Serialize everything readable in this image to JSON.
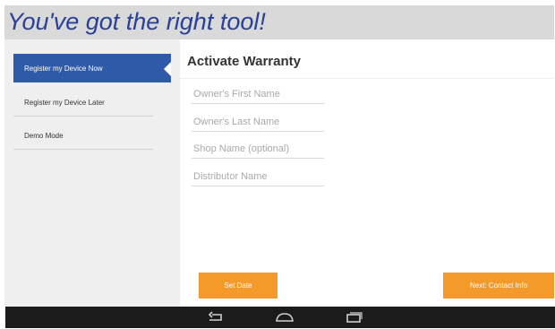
{
  "header": {
    "title": "You've got the right tool!"
  },
  "sidebar": {
    "items": [
      {
        "label": "Register my Device Now",
        "active": true
      },
      {
        "label": "Register my Device Later",
        "active": false
      },
      {
        "label": "Demo Mode",
        "active": false
      }
    ]
  },
  "form": {
    "title": "Activate Warranty",
    "fields": [
      {
        "placeholder": "Owner's First Name",
        "value": ""
      },
      {
        "placeholder": "Owner's Last Name",
        "value": ""
      },
      {
        "placeholder": "Shop Name (optional)",
        "value": ""
      },
      {
        "placeholder": "Distributor Name",
        "value": ""
      }
    ],
    "set_date_label": "Set Date",
    "next_label": "Next: Contact Info"
  },
  "navbar": {
    "icons": [
      "back-icon",
      "home-icon",
      "recent-apps-icon"
    ]
  },
  "colors": {
    "accent": "#f39a2b",
    "active_item": "#2f5aa7",
    "title_blue": "#2a3f96"
  }
}
